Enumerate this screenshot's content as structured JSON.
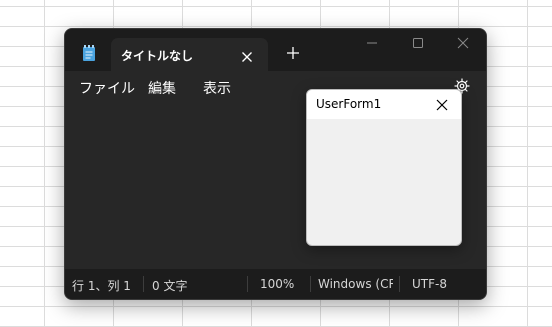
{
  "notepad": {
    "tab": {
      "title": "タイトルなし"
    },
    "menu": {
      "file": "ファイル",
      "edit": "編集",
      "view": "表示"
    },
    "status": {
      "position": "行 1、列 1",
      "chars": "0 文字",
      "zoom": "100%",
      "line_ending": "Windows (CRLF)",
      "encoding": "UTF-8"
    },
    "icons": {
      "app": "notepad-icon",
      "tab_close": "close-icon",
      "new_tab": "plus-icon",
      "minimize": "minimize-icon",
      "maximize": "maximize-icon",
      "close": "close-icon",
      "settings": "gear-icon"
    },
    "colors": {
      "background": "#202020",
      "accent": "#4aa3df"
    }
  },
  "userform": {
    "title": "UserForm1",
    "icons": {
      "close": "close-icon"
    }
  }
}
